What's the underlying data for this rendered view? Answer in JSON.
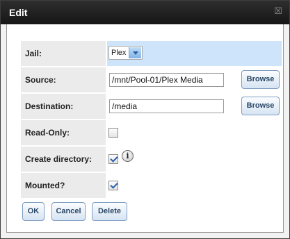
{
  "dialog": {
    "title": "Edit",
    "close_glyph": "☒"
  },
  "form": {
    "jail": {
      "label": "Jail:",
      "value": "Plex"
    },
    "source": {
      "label": "Source:",
      "value": "/mnt/Pool-01/Plex Media",
      "browse_label": "Browse"
    },
    "destination": {
      "label": "Destination:",
      "value": "/media",
      "browse_label": "Browse"
    },
    "read_only": {
      "label": "Read-Only:",
      "checked": false
    },
    "create_directory": {
      "label": "Create directory:",
      "checked": true,
      "info_glyph": "i"
    },
    "mounted": {
      "label": "Mounted?",
      "checked": true
    }
  },
  "actions": {
    "ok": "OK",
    "cancel": "Cancel",
    "delete": "Delete"
  }
}
